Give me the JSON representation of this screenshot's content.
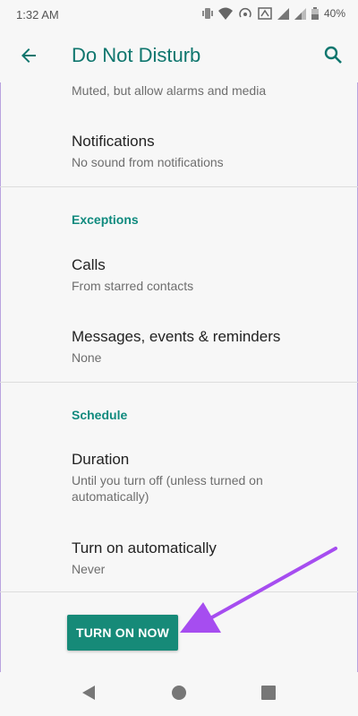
{
  "status_bar": {
    "time": "1:32 AM",
    "battery": "40%",
    "icons": [
      "vibrate-icon",
      "wifi-icon",
      "hotspot-icon",
      "data-icon",
      "signal-icon",
      "signal-2-icon",
      "battery-icon"
    ]
  },
  "app_bar": {
    "title": "Do Not Disturb",
    "back_icon": "arrow-back-icon",
    "search_icon": "search-icon"
  },
  "rows": {
    "behaviour_partial_sub": "Muted, but allow alarms and media",
    "notifications": {
      "title": "Notifications",
      "sub": "No sound from notifications"
    },
    "exceptions_header": "Exceptions",
    "calls": {
      "title": "Calls",
      "sub": "From starred contacts"
    },
    "messages": {
      "title": "Messages, events & reminders",
      "sub": "None"
    },
    "schedule_header": "Schedule",
    "duration": {
      "title": "Duration",
      "sub": "Until you turn off (unless turned on automatically)"
    },
    "auto": {
      "title": "Turn on automatically",
      "sub": "Never"
    }
  },
  "action": {
    "turn_on_label": "TURN ON NOW"
  },
  "colors": {
    "accent": "#0f766e",
    "button": "#168a78",
    "annotation_arrow": "#a64df0"
  },
  "nav_bar": {
    "icons": [
      "back-triangle-icon",
      "home-circle-icon",
      "recents-square-icon"
    ]
  }
}
